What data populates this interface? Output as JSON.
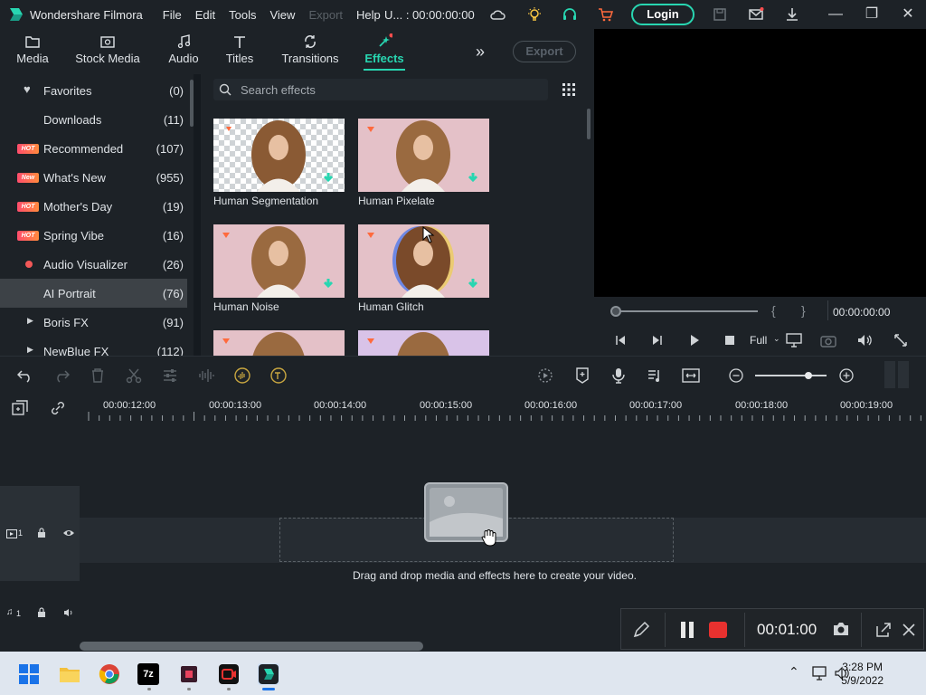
{
  "titlebar": {
    "app_name": "Wondershare Filmora",
    "menu": [
      "File",
      "Edit",
      "Tools",
      "View",
      "Export",
      "Help"
    ],
    "project_timecode": "U... : 00:00:00:00",
    "login": "Login",
    "colors": {
      "accent": "#28d6b1"
    }
  },
  "tabs": [
    {
      "label": "Media",
      "icon": "folder-icon"
    },
    {
      "label": "Stock Media",
      "icon": "stock-media-icon"
    },
    {
      "label": "Audio",
      "icon": "music-note-icon"
    },
    {
      "label": "Titles",
      "icon": "text-t-icon"
    },
    {
      "label": "Transitions",
      "icon": "transitions-icon"
    },
    {
      "label": "Effects",
      "icon": "effects-icon",
      "active": true
    }
  ],
  "export_label": "Export",
  "sidebar": {
    "items": [
      {
        "label": "Favorites",
        "count": "(0)",
        "icon": "heart-icon"
      },
      {
        "label": "Downloads",
        "count": "(11)"
      },
      {
        "label": "Recommended",
        "count": "(107)",
        "badge": "HOT"
      },
      {
        "label": "What's New",
        "count": "(955)",
        "badge": "New"
      },
      {
        "label": "Mother's Day",
        "count": "(19)",
        "badge": "HOT"
      },
      {
        "label": "Spring Vibe",
        "count": "(16)",
        "badge": "HOT"
      },
      {
        "label": "Audio Visualizer",
        "count": "(26)",
        "icon": "red-dot-icon"
      },
      {
        "label": "AI Portrait",
        "count": "(76)",
        "selected": true
      },
      {
        "label": "Boris FX",
        "count": "(91)",
        "icon": "expand-arrow-icon"
      },
      {
        "label": "NewBlue FX",
        "count": "(112)",
        "icon": "expand-arrow-icon"
      }
    ]
  },
  "search": {
    "placeholder": "Search effects"
  },
  "effects": [
    {
      "name": "Human Segmentation"
    },
    {
      "name": "Human Pixelate"
    },
    {
      "name": "Human Noise"
    },
    {
      "name": "Human Glitch"
    }
  ],
  "preview": {
    "timecode": "00:00:00:00",
    "zoom": "Full"
  },
  "timeline": {
    "ruler_labels": [
      "00:00:12:00",
      "00:00:13:00",
      "00:00:14:00",
      "00:00:15:00",
      "00:00:16:00",
      "00:00:17:00",
      "00:00:18:00",
      "00:00:19:00"
    ],
    "video_track_label": "1",
    "audio_track_label": "1",
    "drop_hint": "Drag and drop media and effects here to create your video.",
    "zoom_level": 0.75
  },
  "recorder": {
    "elapsed": "00:01:00"
  },
  "taskbar": {
    "time": "3:28 PM",
    "date": "5/9/2022"
  }
}
